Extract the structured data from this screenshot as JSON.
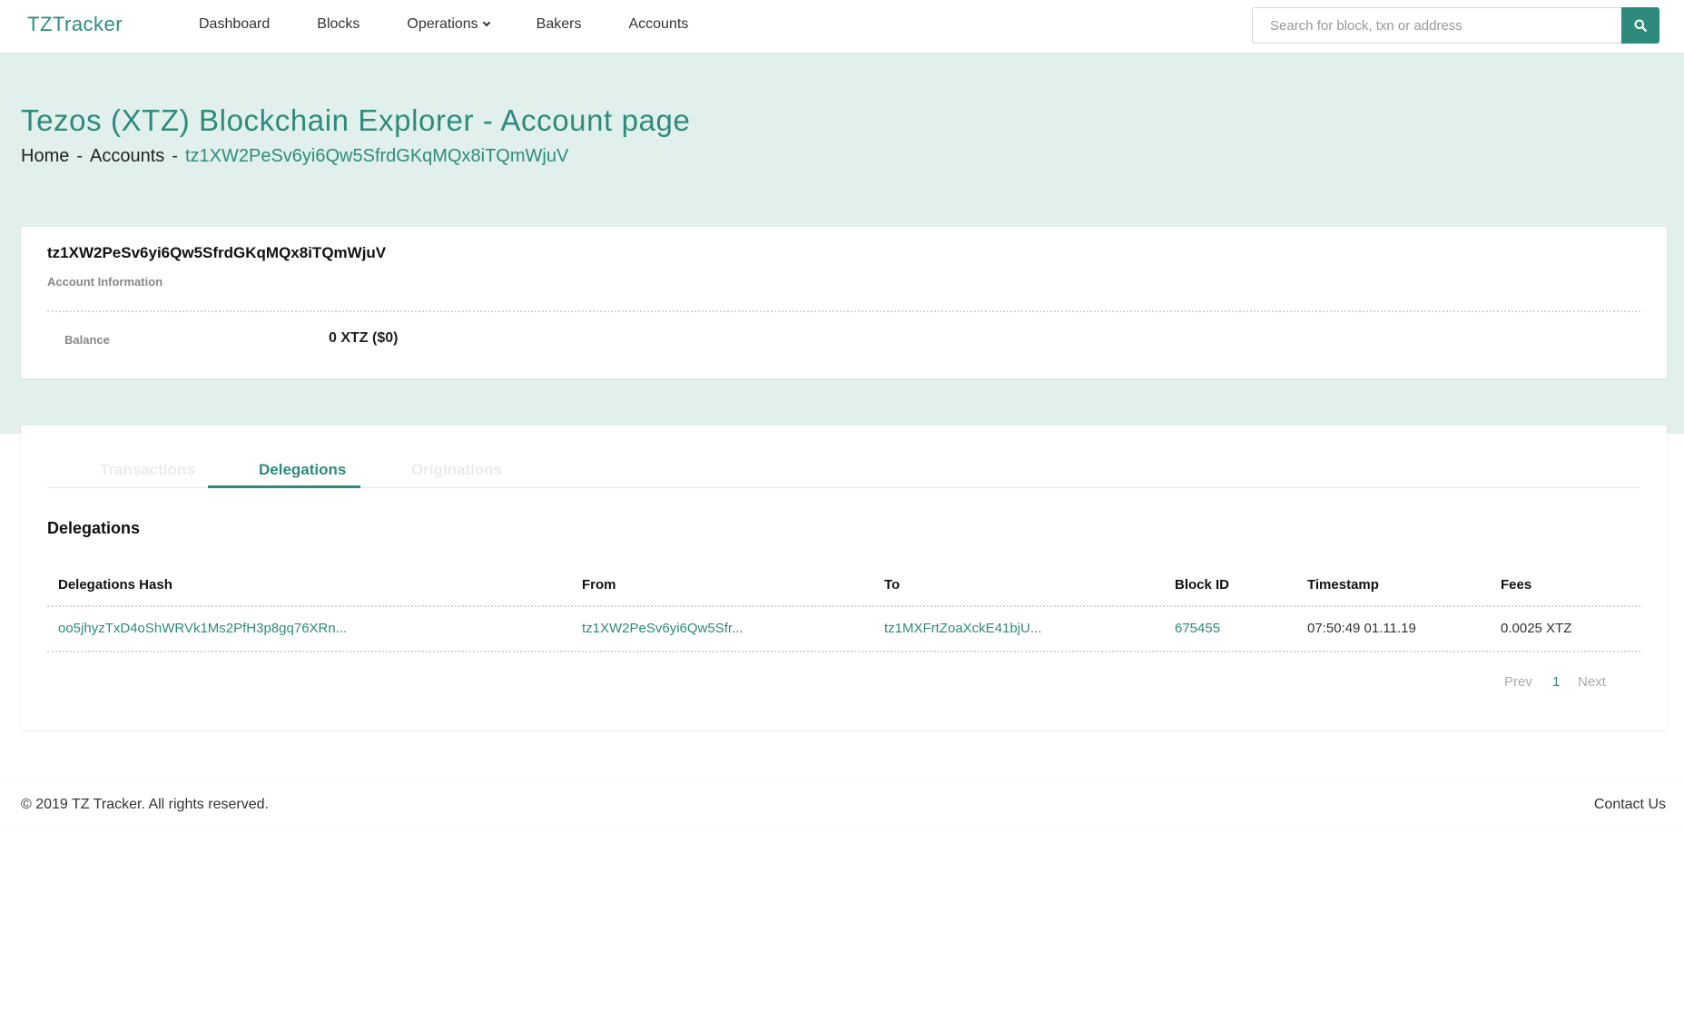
{
  "navbar": {
    "brand": "TZTracker",
    "links": [
      {
        "label": "Dashboard"
      },
      {
        "label": "Blocks"
      },
      {
        "label": "Operations"
      },
      {
        "label": "Bakers"
      },
      {
        "label": "Accounts"
      }
    ],
    "search": {
      "placeholder": "Search for block, txn or address",
      "value": ""
    }
  },
  "hero": {
    "title": "Tezos (XTZ) Blockchain Explorer - Account page",
    "breadcrumb": {
      "home": "Home",
      "sep": "-",
      "accounts": "Accounts",
      "current": "tz1XW2PeSv6yi6Qw5SfrdGKqMQx8iTQmWjuV"
    }
  },
  "account": {
    "address": "tz1XW2PeSv6yi6Qw5SfrdGKqMQx8iTQmWjuV",
    "subtitle": "Account Information",
    "balance_label": "Balance",
    "balance_value": "0 XTZ ($0)"
  },
  "tabs": [
    {
      "label": "Transactions",
      "active": false
    },
    {
      "label": "Delegations",
      "active": true
    },
    {
      "label": "Originations",
      "active": false
    }
  ],
  "delegations": {
    "title": "Delegations",
    "columns": [
      "Delegations Hash",
      "From",
      "To",
      "Block ID",
      "Timestamp",
      "Fees"
    ],
    "rows": [
      {
        "hash": "oo5jhyzTxD4oShWRVk1Ms2PfH3p8gq76XRn...",
        "from": "tz1XW2PeSv6yi6Qw5Sfr...",
        "to": "tz1MXFrtZoaXckE41bjU...",
        "block_id": "675455",
        "timestamp": "07:50:49 01.11.19",
        "fees": "0.0025 XTZ"
      }
    ],
    "pagination": {
      "prev": "Prev",
      "page": "1",
      "next": "Next"
    }
  },
  "footer": {
    "copyright": "© 2019 TZ Tracker. All rights reserved.",
    "contact": "Contact Us"
  },
  "colors": {
    "accent": "#2e8b7c",
    "hero_bg": "#e1f0ed"
  }
}
